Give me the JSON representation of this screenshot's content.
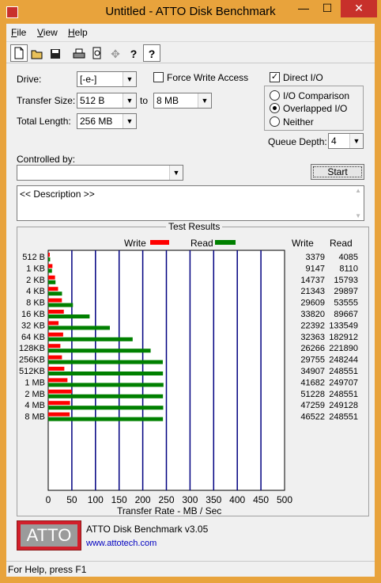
{
  "window": {
    "title": "Untitled - ATTO Disk Benchmark",
    "minimize": "—",
    "maximize": "☐",
    "close": "✕"
  },
  "menu": [
    {
      "pre": "",
      "acc": "F",
      "post": "ile"
    },
    {
      "pre": "",
      "acc": "V",
      "post": "iew"
    },
    {
      "pre": "",
      "acc": "H",
      "post": "elp"
    }
  ],
  "toolbar": {
    "icons": [
      "new-icon",
      "open-icon",
      "save-icon",
      "print-icon",
      "print-preview-icon",
      "move-icon",
      "help-icon",
      "context-help-icon"
    ]
  },
  "settings": {
    "drive_label": "Drive:",
    "drive_value": "[-e-]",
    "force_write_label": "Force Write Access",
    "force_write_checked": false,
    "direct_io_label": "Direct I/O",
    "direct_io_checked": true,
    "transfer_size_label": "Transfer Size:",
    "transfer_from": "512 B",
    "to_label": "to",
    "transfer_to": "8 MB",
    "total_length_label": "Total Length:",
    "total_length": "256 MB",
    "io_options": [
      "I/O Comparison",
      "Overlapped I/O",
      "Neither"
    ],
    "io_selected": "Overlapped I/O",
    "queue_depth_label": "Queue Depth:",
    "queue_depth": "4",
    "controlled_by_label": "Controlled by:",
    "controlled_by_value": "",
    "start_label": "Start",
    "description": "<< Description >>"
  },
  "results": {
    "title": "Test Results",
    "write_legend": "Write",
    "read_legend": "Read",
    "col_write": "Write",
    "col_read": "Read",
    "xlabel": "Transfer Rate - MB / Sec",
    "colors": {
      "write": "#ff0000",
      "read": "#008000",
      "grid": "#000080"
    }
  },
  "chart_data": {
    "type": "bar",
    "orientation": "horizontal",
    "title": "Test Results",
    "xlabel": "Transfer Rate - MB / Sec",
    "xlim": [
      0,
      500
    ],
    "xticks": [
      0,
      50,
      100,
      150,
      200,
      250,
      300,
      350,
      400,
      450,
      500
    ],
    "categories": [
      "512 B",
      "1 KB",
      "2 KB",
      "4 KB",
      "8 KB",
      "16 KB",
      "32 KB",
      "64 KB",
      "128KB",
      "256KB",
      "512KB",
      "1 MB",
      "2 MB",
      "4 MB",
      "8 MB"
    ],
    "series": [
      {
        "name": "Write",
        "color": "#ff0000",
        "values": [
          3379,
          9147,
          14737,
          21343,
          29609,
          33820,
          22392,
          32363,
          26266,
          29755,
          34907,
          41682,
          51228,
          47259,
          46522
        ]
      },
      {
        "name": "Read",
        "color": "#008000",
        "values": [
          4085,
          8110,
          15793,
          29897,
          53555,
          89667,
          133549,
          182912,
          221890,
          248244,
          248551,
          249707,
          248551,
          249128,
          248551
        ]
      }
    ]
  },
  "footer": {
    "logo_text": "ATTO",
    "product": "ATTO Disk Benchmark v3.05",
    "url": "www.attotech.com"
  },
  "status": "For Help, press F1"
}
